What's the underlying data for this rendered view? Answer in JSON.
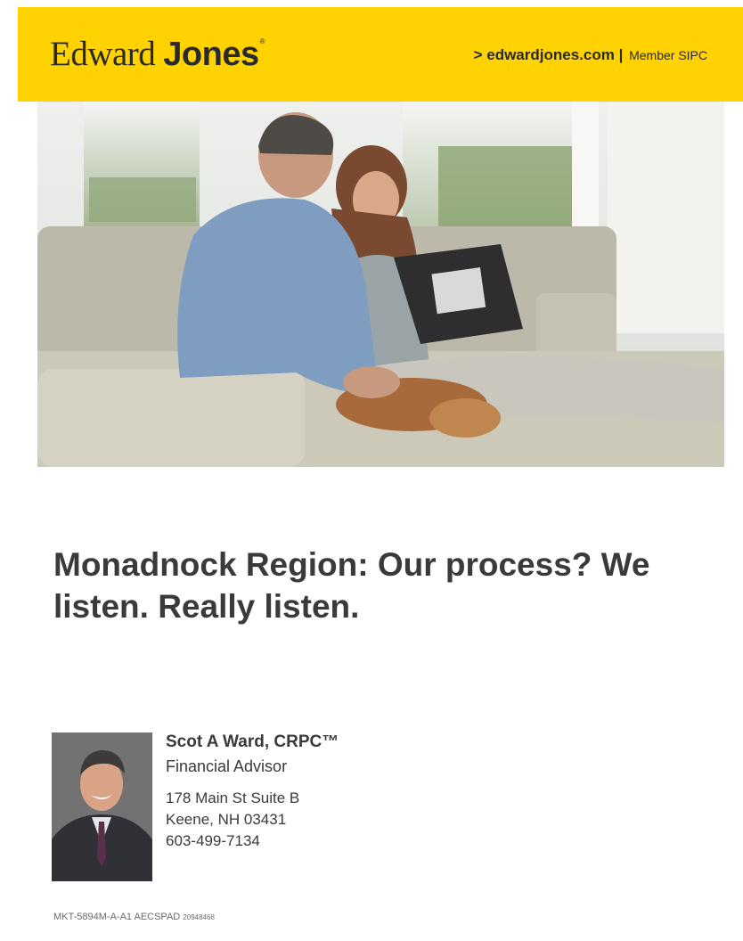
{
  "header": {
    "logo_word1": "Edward",
    "logo_word2": "Jones",
    "logo_mark": "®",
    "site_link": "> edwardjones.com",
    "separator": "|",
    "member": "Member SIPC",
    "brand_color": "#FFD200"
  },
  "hero": {
    "image": "couple-on-couch-with-dog-photo"
  },
  "headline": "Monadnock Region:  Our process? We listen. Really listen.",
  "advisor": {
    "name": "Scot A Ward, CRPC™",
    "title": "Financial Advisor",
    "address_line1": "178 Main St Suite B",
    "address_line2": "Keene, NH 03431",
    "phone": "603-499-7134",
    "photo": "advisor-headshot-photo"
  },
  "footer": {
    "code": "MKT-5894M-A-A1 AECSPAD",
    "code_small": "20948468"
  }
}
